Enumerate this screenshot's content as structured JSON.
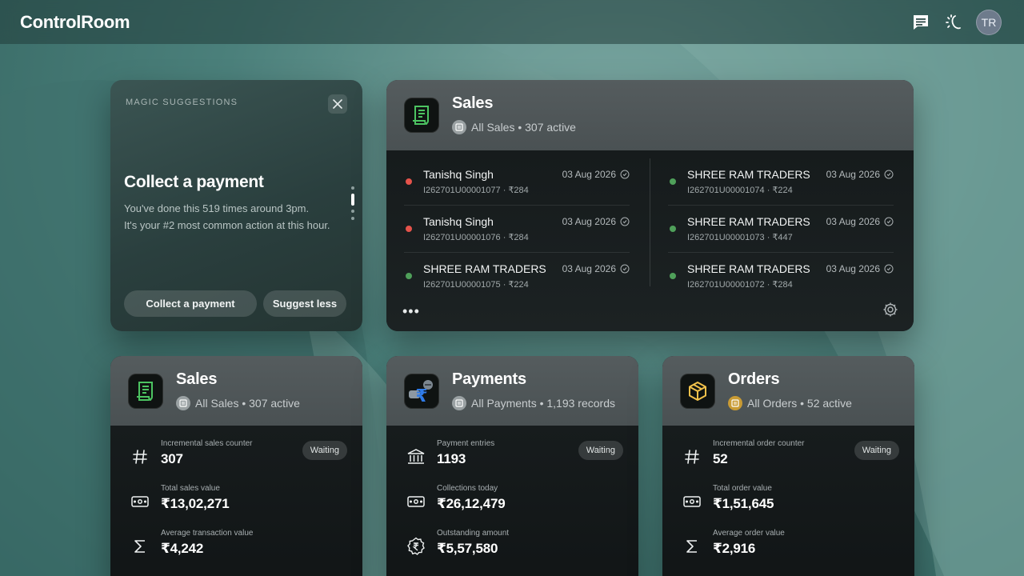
{
  "app": {
    "title": "ControlRoom",
    "avatar_initials": "TR"
  },
  "topbar": {
    "icons": [
      "chat-icon",
      "magic-wand-icon"
    ]
  },
  "magic": {
    "label": "MAGIC SUGGESTIONS",
    "title": "Collect a payment",
    "desc_line1": "You've done this 519 times around 3pm.",
    "desc_line2": "It's your #2 most common action at this hour.",
    "primary_label": "Collect a payment",
    "secondary_label": "Suggest less"
  },
  "sales_card": {
    "title": "Sales",
    "subtitle": "All Sales • 307 active",
    "left": [
      {
        "name": "Tanishq Singh",
        "ref": "I262701U00001077 · ₹284",
        "date": "03 Aug 2026",
        "status": "red"
      },
      {
        "name": "Tanishq Singh",
        "ref": "I262701U00001076 · ₹284",
        "date": "03 Aug 2026",
        "status": "red"
      },
      {
        "name": "SHREE RAM TRADERS",
        "ref": "I262701U00001075 · ₹224",
        "date": "03 Aug 2026",
        "status": "green"
      }
    ],
    "right": [
      {
        "name": "SHREE RAM TRADERS",
        "ref": "I262701U00001074 · ₹224",
        "date": "03 Aug 2026",
        "status": "green"
      },
      {
        "name": "SHREE RAM TRADERS",
        "ref": "I262701U00001073 · ₹447",
        "date": "03 Aug 2026",
        "status": "green"
      },
      {
        "name": "SHREE RAM TRADERS",
        "ref": "I262701U00001072 · ₹284",
        "date": "03 Aug 2026",
        "status": "green"
      }
    ],
    "more": "•••"
  },
  "metric_cards": [
    {
      "title": "Sales",
      "subtitle": "All Sales • 307 active",
      "status": "Waiting",
      "rows": [
        {
          "label": "Incremental sales counter",
          "value": "307"
        },
        {
          "label": "Total sales value",
          "value": "₹13,02,271"
        },
        {
          "label": "Average transaction value",
          "value": "₹4,242"
        }
      ]
    },
    {
      "title": "Payments",
      "subtitle": "All Payments • 1,193 records",
      "status": "Waiting",
      "rows": [
        {
          "label": "Payment entries",
          "value": "1193"
        },
        {
          "label": "Collections today",
          "value": "₹26,12,479"
        },
        {
          "label": "Outstanding amount",
          "value": "₹5,57,580"
        }
      ]
    },
    {
      "title": "Orders",
      "subtitle": "All Orders • 52 active",
      "status": "Waiting",
      "rows": [
        {
          "label": "Incremental order counter",
          "value": "52"
        },
        {
          "label": "Total order value",
          "value": "₹1,51,645"
        },
        {
          "label": "Average order value",
          "value": "₹2,916"
        }
      ]
    }
  ]
}
